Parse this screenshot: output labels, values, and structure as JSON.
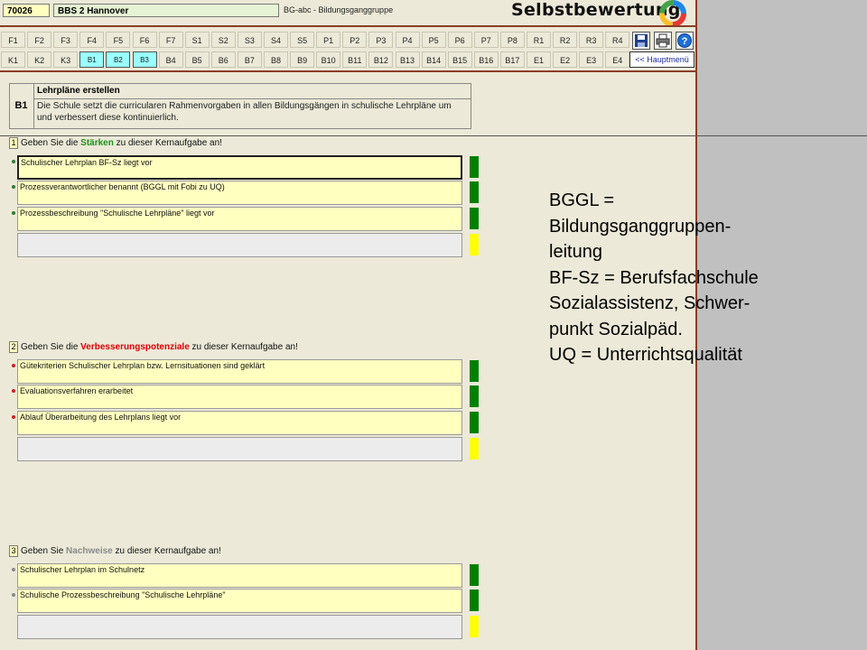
{
  "header": {
    "id_value": "70026",
    "school_value": "BBS 2 Hannover",
    "group_text": "BG-abc - Bildungsganggruppe",
    "brand": "Selbstbewertung"
  },
  "nav": {
    "row1": [
      "F1",
      "F2",
      "F3",
      "F4",
      "F5",
      "F6",
      "F7",
      "S1",
      "S2",
      "S3",
      "S4",
      "S5",
      "P1",
      "P2",
      "P3",
      "P4",
      "P5",
      "P6",
      "P7",
      "P8",
      "R1",
      "R2",
      "R3",
      "R4"
    ],
    "row2": [
      "K1",
      "K2",
      "K3",
      "B1",
      "B2",
      "B3",
      "B4",
      "B5",
      "B6",
      "B7",
      "B8",
      "B9",
      "B10",
      "B11",
      "B12",
      "B13",
      "B14",
      "B15",
      "B16",
      "B17",
      "E1",
      "E2",
      "E3",
      "E4"
    ],
    "highlighted": [
      "B1",
      "B2",
      "B3"
    ],
    "home_label": "<< Hauptmenü",
    "tools": [
      "save-icon",
      "print-icon",
      "help-icon"
    ]
  },
  "task": {
    "code": "B1",
    "title": "Lehrpläne erstellen",
    "description": "Die Schule setzt die curricularen Rahmenvorgaben in allen Bildungsgängen in schulische Lehrpläne um und verbessert diese kontinuierlich."
  },
  "sections": [
    {
      "number": "1",
      "prefix": "Geben Sie die ",
      "keyword": "Stärken",
      "suffix": " zu dieser Kernaufgabe an!",
      "keyword_color": "#1f8f1f",
      "dot_color": "#2e7d2e",
      "items": [
        "Schulischer Lehrplan BF-Sz liegt vor",
        "Prozessverantwortlicher benannt (BGGL mit Fobi zu UQ)",
        "Prozessbeschreibung \"Schulische Lehrpläne\" liegt vor",
        ""
      ],
      "bar_colors": [
        "#008000",
        "#008000",
        "#008000",
        "#ffff00"
      ]
    },
    {
      "number": "2",
      "prefix": "Geben Sie die ",
      "keyword": "Verbesserungspotenziale",
      "suffix": " zu dieser Kernaufgabe an!",
      "keyword_color": "#e00000",
      "dot_color": "#d02020",
      "items": [
        "Gütekriterien Schulischer Lehrplan bzw. Lernsituationen sind geklärt",
        "Evaluationsverfahren erarbeitet",
        "Ablauf Überarbeitung des Lehrplans liegt vor",
        ""
      ],
      "bar_colors": [
        "#008000",
        "#008000",
        "#008000",
        "#ffff00"
      ]
    },
    {
      "number": "3",
      "prefix": "Geben Sie ",
      "keyword": "Nachweise",
      "suffix": " zu dieser Kernaufgabe an!",
      "keyword_color": "#8a8a8a",
      "dot_color": "#888888",
      "items": [
        "Schulischer Lehrplan im Schulnetz",
        "Schulische Prozessbeschreibung \"Schulische Lehrpläne\"",
        ""
      ],
      "bar_colors": [
        "#008000",
        "#008000",
        "#ffff00"
      ]
    }
  ],
  "annotation": [
    "BGGL =",
    "Bildungsganggruppen-",
    "leitung",
    "BF-Sz = Berufsfachschule",
    "Sozialassistenz, Schwer-",
    "punkt Sozialpäd.",
    "UQ = Unterrichtsqualität"
  ]
}
